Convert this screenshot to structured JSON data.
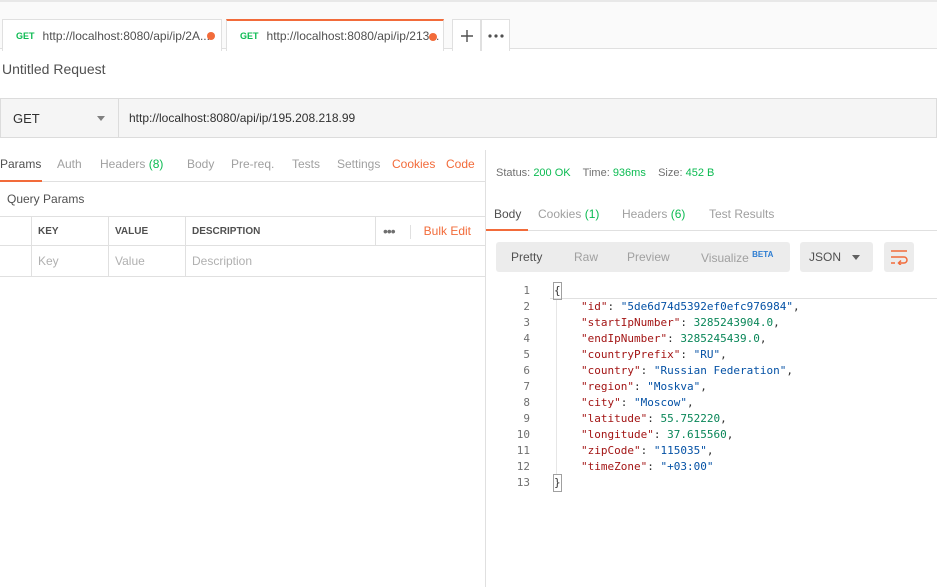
{
  "tabs": [
    {
      "method": "GET",
      "url": "http://localhost:8080/api/ip/2A..."
    },
    {
      "method": "GET",
      "url": "http://localhost:8080/api/ip/213..."
    }
  ],
  "request": {
    "name": "Untitled Request",
    "method": "GET",
    "url": "http://localhost:8080/api/ip/195.208.218.99"
  },
  "request_tabs": {
    "params": "Params",
    "auth": "Auth",
    "headers": "Headers",
    "headers_count": "(8)",
    "body": "Body",
    "prereq": "Pre-req.",
    "tests": "Tests",
    "settings": "Settings",
    "cookies": "Cookies",
    "code": "Code"
  },
  "query_params": {
    "title": "Query Params",
    "headers": {
      "key": "KEY",
      "value": "VALUE",
      "description": "DESCRIPTION"
    },
    "bulk_edit": "Bulk Edit",
    "placeholders": {
      "key": "Key",
      "value": "Value",
      "description": "Description"
    }
  },
  "response": {
    "status_label": "Status:",
    "status": "200 OK",
    "time_label": "Time:",
    "time": "936ms",
    "size_label": "Size:",
    "size": "452 B",
    "tabs": {
      "body": "Body",
      "cookies": "Cookies",
      "cookies_count": "(1)",
      "headers": "Headers",
      "headers_count": "(6)",
      "test_results": "Test Results"
    },
    "formats": {
      "pretty": "Pretty",
      "raw": "Raw",
      "preview": "Preview",
      "visualize": "Visualize",
      "beta": "BETA",
      "type": "JSON"
    },
    "json_lines": [
      {
        "n": "1",
        "text": "{"
      },
      {
        "n": "2",
        "key": "\"id\"",
        "value": "\"5de6d74d5392ef0efc976984\"",
        "type": "s",
        "comma": ","
      },
      {
        "n": "3",
        "key": "\"startIpNumber\"",
        "value": "3285243904.0",
        "type": "n",
        "comma": ","
      },
      {
        "n": "4",
        "key": "\"endIpNumber\"",
        "value": "3285245439.0",
        "type": "n",
        "comma": ","
      },
      {
        "n": "5",
        "key": "\"countryPrefix\"",
        "value": "\"RU\"",
        "type": "s",
        "comma": ","
      },
      {
        "n": "6",
        "key": "\"country\"",
        "value": "\"Russian Federation\"",
        "type": "s",
        "comma": ","
      },
      {
        "n": "7",
        "key": "\"region\"",
        "value": "\"Moskva\"",
        "type": "s",
        "comma": ","
      },
      {
        "n": "8",
        "key": "\"city\"",
        "value": "\"Moscow\"",
        "type": "s",
        "comma": ","
      },
      {
        "n": "9",
        "key": "\"latitude\"",
        "value": "55.752220",
        "type": "n",
        "comma": ","
      },
      {
        "n": "10",
        "key": "\"longitude\"",
        "value": "37.615560",
        "type": "n",
        "comma": ","
      },
      {
        "n": "11",
        "key": "\"zipCode\"",
        "value": "\"115035\"",
        "type": "s",
        "comma": ","
      },
      {
        "n": "12",
        "key": "\"timeZone\"",
        "value": "\"+03:00\"",
        "type": "s",
        "comma": ""
      },
      {
        "n": "13",
        "text": "}"
      }
    ]
  },
  "colors": {
    "accent": "#f26b3a",
    "success": "#0cbb52",
    "link": "#2d7dd2"
  }
}
